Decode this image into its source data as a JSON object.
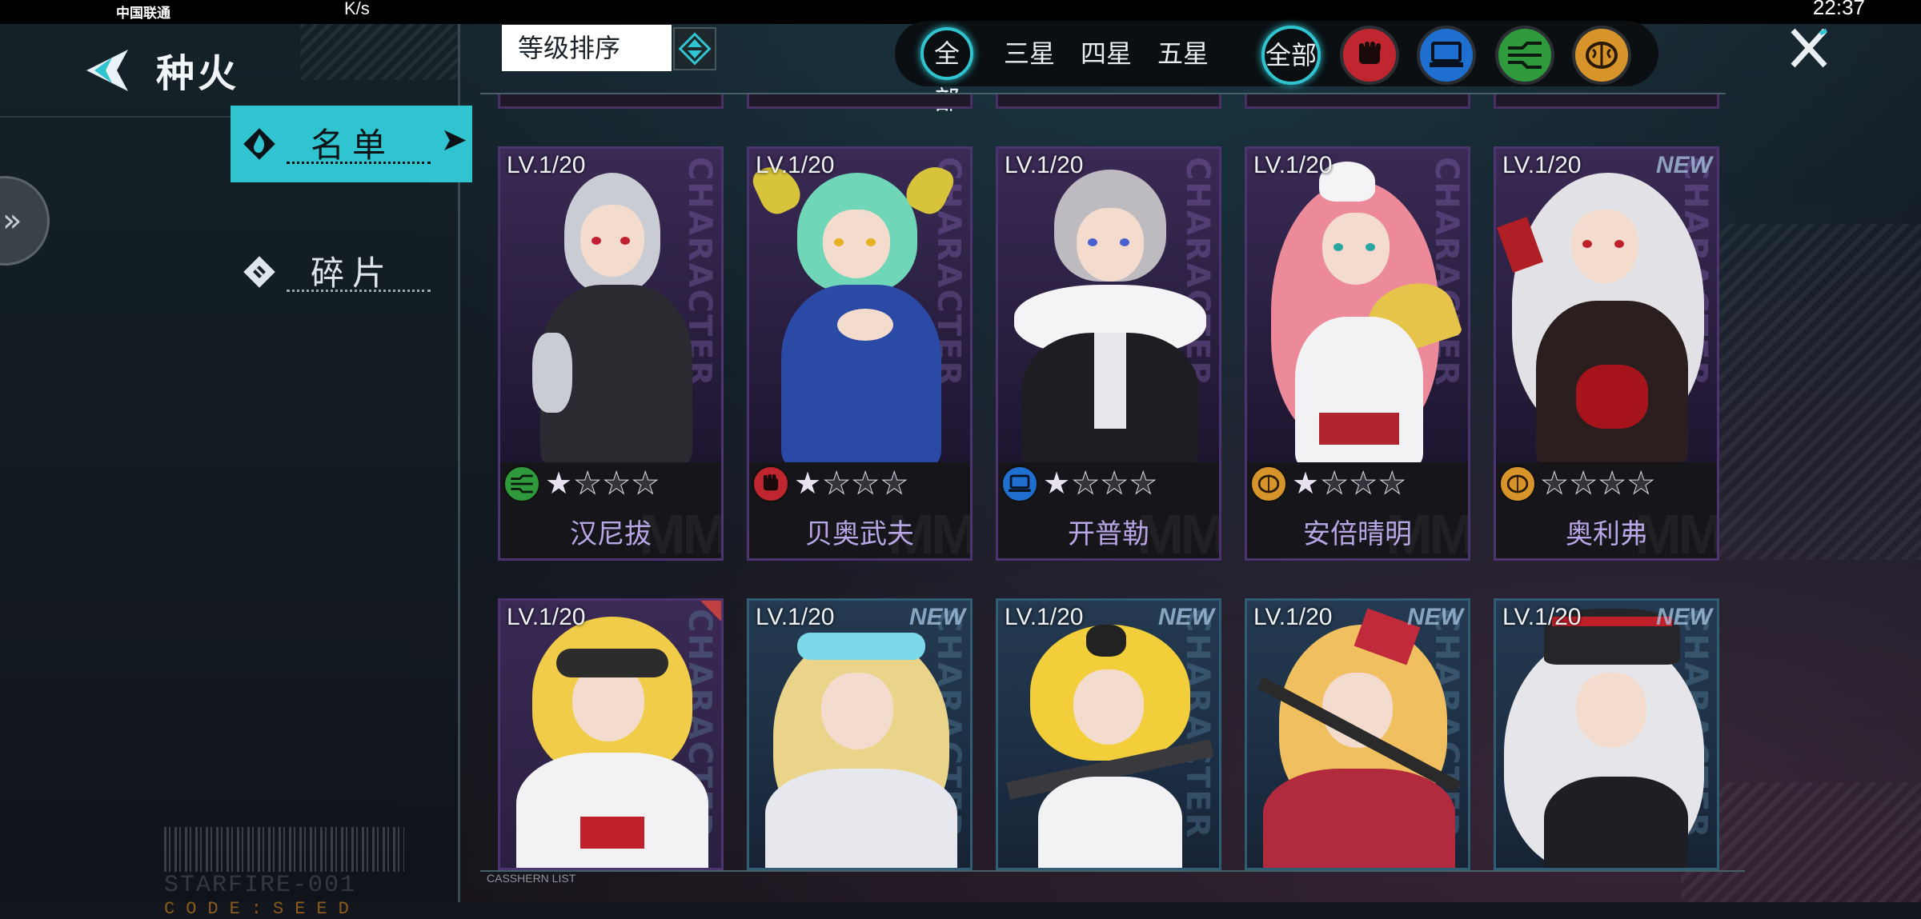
{
  "status_bar": {
    "carrier": "中国联通",
    "net_speed": "K/s",
    "time": "22:37"
  },
  "header": {
    "title": "种火"
  },
  "side_tabs": [
    {
      "label": "名单",
      "active": true
    },
    {
      "label": "碎片",
      "active": false
    }
  ],
  "sort": {
    "label": "等级排序"
  },
  "filters": {
    "rarity": [
      "全部",
      "三星",
      "四星",
      "五星"
    ],
    "type_all": "全部",
    "types": [
      {
        "icon": "fist-icon",
        "color": "#c0262f"
      },
      {
        "icon": "computer-icon",
        "color": "#1f6fd0"
      },
      {
        "icon": "circuit-icon",
        "color": "#2f9a3c"
      },
      {
        "icon": "brain-icon",
        "color": "#d7942a"
      }
    ]
  },
  "colors": {
    "accent": "#2fc4cf",
    "name_text": "#b9a6e6",
    "fist": "#c0262f",
    "computer": "#1f6fd0",
    "circuit": "#2f9a3c",
    "brain": "#d7942a"
  },
  "cards": [
    {
      "level": "LV.1/20",
      "name": "汉尼拔",
      "type_icon": "circuit-icon",
      "stars_filled": 1,
      "stars_total": 4,
      "new": false,
      "portrait_word": "CHARACTER"
    },
    {
      "level": "LV.1/20",
      "name": "贝奥武夫",
      "type_icon": "fist-icon",
      "stars_filled": 1,
      "stars_total": 4,
      "new": false,
      "portrait_word": "CHARACTER"
    },
    {
      "level": "LV.1/20",
      "name": "开普勒",
      "type_icon": "computer-icon",
      "stars_filled": 1,
      "stars_total": 4,
      "new": false,
      "portrait_word": "CHARACTER"
    },
    {
      "level": "LV.1/20",
      "name": "安倍晴明",
      "type_icon": "brain-icon",
      "stars_filled": 1,
      "stars_total": 4,
      "new": false,
      "portrait_word": "CHARACTER"
    },
    {
      "level": "LV.1/20",
      "name": "奥利弗",
      "type_icon": "brain-icon",
      "stars_filled": 0,
      "stars_total": 4,
      "new": true,
      "portrait_word": "CHARACTER"
    },
    {
      "level": "LV.1/20",
      "new": false
    },
    {
      "level": "LV.1/20",
      "new": true
    },
    {
      "level": "LV.1/20",
      "new": true
    },
    {
      "level": "LV.1/20",
      "new": true
    },
    {
      "level": "LV.1/20",
      "new": true
    }
  ],
  "new_label": "NEW",
  "footer": {
    "barcode_text": "STARFIRE-001",
    "code_text": "CODE:SEED",
    "list_tag": "CASSHERN LIST"
  }
}
